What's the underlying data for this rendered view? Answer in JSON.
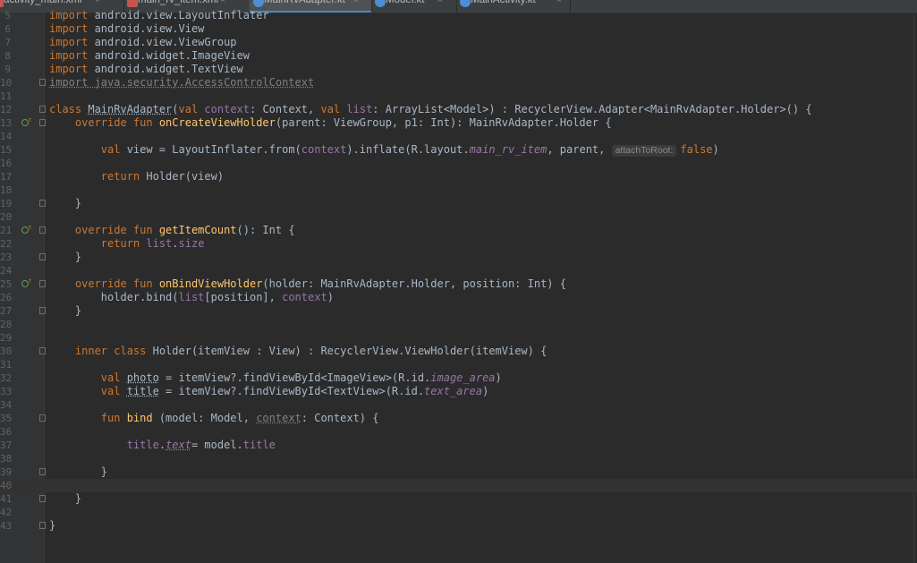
{
  "tabs": [
    {
      "label": "activity_main.xml",
      "type": "xml",
      "active": false
    },
    {
      "label": "main_rv_item.xml",
      "type": "xml",
      "active": false
    },
    {
      "label": "MainRvAdapter.kt",
      "type": "kt",
      "active": true
    },
    {
      "label": "Model.kt",
      "type": "kt",
      "active": false
    },
    {
      "label": "MainActivity.kt",
      "type": "kt",
      "active": false
    }
  ],
  "tab_close_glyph": "×",
  "gutter_markers": {
    "override_icon": "override-icon"
  },
  "current_line": "40",
  "lines": [
    {
      "n": "5",
      "tokens": [
        {
          "t": "import",
          "c": "k"
        },
        {
          "t": " android.view.LayoutInflater"
        }
      ]
    },
    {
      "n": "6",
      "tokens": [
        {
          "t": "import",
          "c": "k"
        },
        {
          "t": " android.view.View"
        }
      ]
    },
    {
      "n": "7",
      "tokens": [
        {
          "t": "import",
          "c": "k"
        },
        {
          "t": " android.view.ViewGroup"
        }
      ]
    },
    {
      "n": "8",
      "tokens": [
        {
          "t": "import",
          "c": "k"
        },
        {
          "t": " android.widget.ImageView"
        }
      ]
    },
    {
      "n": "9",
      "tokens": [
        {
          "t": "import",
          "c": "k"
        },
        {
          "t": " android.widget.TextView"
        }
      ]
    },
    {
      "n": "10",
      "fold": true,
      "tokens": [
        {
          "t": "import java.security.AccessControlContext",
          "c": "dim u"
        }
      ]
    },
    {
      "n": "11",
      "tokens": []
    },
    {
      "n": "12",
      "fold": true,
      "tokens": [
        {
          "t": "class ",
          "c": "k"
        },
        {
          "t": "MainRvAdapter",
          "c": "u"
        },
        {
          "t": "("
        },
        {
          "t": "val ",
          "c": "k"
        },
        {
          "t": "context",
          "c": "p"
        },
        {
          "t": ": Context, "
        },
        {
          "t": "val ",
          "c": "k"
        },
        {
          "t": "list",
          "c": "p"
        },
        {
          "t": ": ArrayList<Model>) : RecyclerView.Adapter<MainRvAdapter.Holder>() {"
        }
      ]
    },
    {
      "n": "13",
      "marker": true,
      "fold": true,
      "tokens": [
        {
          "t": "    "
        },
        {
          "t": "override fun ",
          "c": "k"
        },
        {
          "t": "onCreateViewHolder",
          "c": "fn"
        },
        {
          "t": "(parent: ViewGroup, p1: Int): MainRvAdapter.Holder {"
        }
      ]
    },
    {
      "n": "14",
      "tokens": []
    },
    {
      "n": "15",
      "tokens": [
        {
          "t": "        "
        },
        {
          "t": "val ",
          "c": "k"
        },
        {
          "t": "view = LayoutInflater.from("
        },
        {
          "t": "context",
          "c": "p"
        },
        {
          "t": ").inflate(R.layout."
        },
        {
          "t": "main_rv_item",
          "c": "pi"
        },
        {
          "t": ", parent, "
        },
        {
          "t": "attachToRoot:",
          "c": "hint"
        },
        {
          "t": "false",
          "c": "k"
        },
        {
          "t": ")"
        }
      ]
    },
    {
      "n": "16",
      "tokens": []
    },
    {
      "n": "17",
      "tokens": [
        {
          "t": "        "
        },
        {
          "t": "return ",
          "c": "k"
        },
        {
          "t": "Holder(view)"
        }
      ]
    },
    {
      "n": "18",
      "tokens": []
    },
    {
      "n": "19",
      "fold": true,
      "tokens": [
        {
          "t": "    }"
        }
      ]
    },
    {
      "n": "20",
      "tokens": []
    },
    {
      "n": "21",
      "marker": true,
      "fold": true,
      "tokens": [
        {
          "t": "    "
        },
        {
          "t": "override fun ",
          "c": "k"
        },
        {
          "t": "getItemCount",
          "c": "fn"
        },
        {
          "t": "(): Int {"
        }
      ]
    },
    {
      "n": "22",
      "tokens": [
        {
          "t": "        "
        },
        {
          "t": "return ",
          "c": "k"
        },
        {
          "t": "list",
          "c": "p"
        },
        {
          "t": "."
        },
        {
          "t": "size",
          "c": "p"
        }
      ]
    },
    {
      "n": "23",
      "fold": true,
      "tokens": [
        {
          "t": "    }"
        }
      ]
    },
    {
      "n": "24",
      "tokens": []
    },
    {
      "n": "25",
      "marker": true,
      "fold": true,
      "tokens": [
        {
          "t": "    "
        },
        {
          "t": "override fun ",
          "c": "k"
        },
        {
          "t": "onBindViewHolder",
          "c": "fn"
        },
        {
          "t": "(holder: MainRvAdapter.Holder, position: Int) {"
        }
      ]
    },
    {
      "n": "26",
      "tokens": [
        {
          "t": "        holder.bind("
        },
        {
          "t": "list",
          "c": "p"
        },
        {
          "t": "[position], "
        },
        {
          "t": "context",
          "c": "p"
        },
        {
          "t": ")"
        }
      ]
    },
    {
      "n": "27",
      "fold": true,
      "tokens": [
        {
          "t": "    }"
        }
      ]
    },
    {
      "n": "28",
      "tokens": []
    },
    {
      "n": "29",
      "tokens": []
    },
    {
      "n": "30",
      "fold": true,
      "tokens": [
        {
          "t": "    "
        },
        {
          "t": "inner class ",
          "c": "k"
        },
        {
          "t": "Holder(itemView : View) : RecyclerView.ViewHolder(itemView) {"
        }
      ]
    },
    {
      "n": "31",
      "tokens": []
    },
    {
      "n": "32",
      "tokens": [
        {
          "t": "        "
        },
        {
          "t": "val ",
          "c": "k"
        },
        {
          "t": "photo",
          "c": "tx u"
        },
        {
          "t": " = itemView?.findViewById<ImageView>(R.id."
        },
        {
          "t": "image_area",
          "c": "pi"
        },
        {
          "t": ")"
        }
      ]
    },
    {
      "n": "33",
      "tokens": [
        {
          "t": "        "
        },
        {
          "t": "val ",
          "c": "k"
        },
        {
          "t": "title",
          "c": "tx u"
        },
        {
          "t": " = itemView?.findViewById<TextView>(R.id."
        },
        {
          "t": "text_area",
          "c": "pi"
        },
        {
          "t": ")"
        }
      ]
    },
    {
      "n": "34",
      "tokens": []
    },
    {
      "n": "35",
      "fold": true,
      "tokens": [
        {
          "t": "        "
        },
        {
          "t": "fun ",
          "c": "k"
        },
        {
          "t": "bind ",
          "c": "fn"
        },
        {
          "t": "(model: Model, "
        },
        {
          "t": "context",
          "c": "dim u"
        },
        {
          "t": ": Context) {"
        }
      ]
    },
    {
      "n": "36",
      "tokens": []
    },
    {
      "n": "37",
      "tokens": [
        {
          "t": "            "
        },
        {
          "t": "title",
          "c": "p"
        },
        {
          "t": "."
        },
        {
          "t": "text",
          "c": "pi u"
        },
        {
          "t": "= model."
        },
        {
          "t": "title",
          "c": "p"
        }
      ]
    },
    {
      "n": "38",
      "tokens": []
    },
    {
      "n": "39",
      "fold": true,
      "tokens": [
        {
          "t": "        }"
        }
      ]
    },
    {
      "n": "40",
      "tokens": []
    },
    {
      "n": "41",
      "fold": true,
      "tokens": [
        {
          "t": "    }"
        }
      ]
    },
    {
      "n": "42",
      "tokens": []
    },
    {
      "n": "43",
      "fold": true,
      "tokens": [
        {
          "t": "}"
        }
      ]
    }
  ]
}
